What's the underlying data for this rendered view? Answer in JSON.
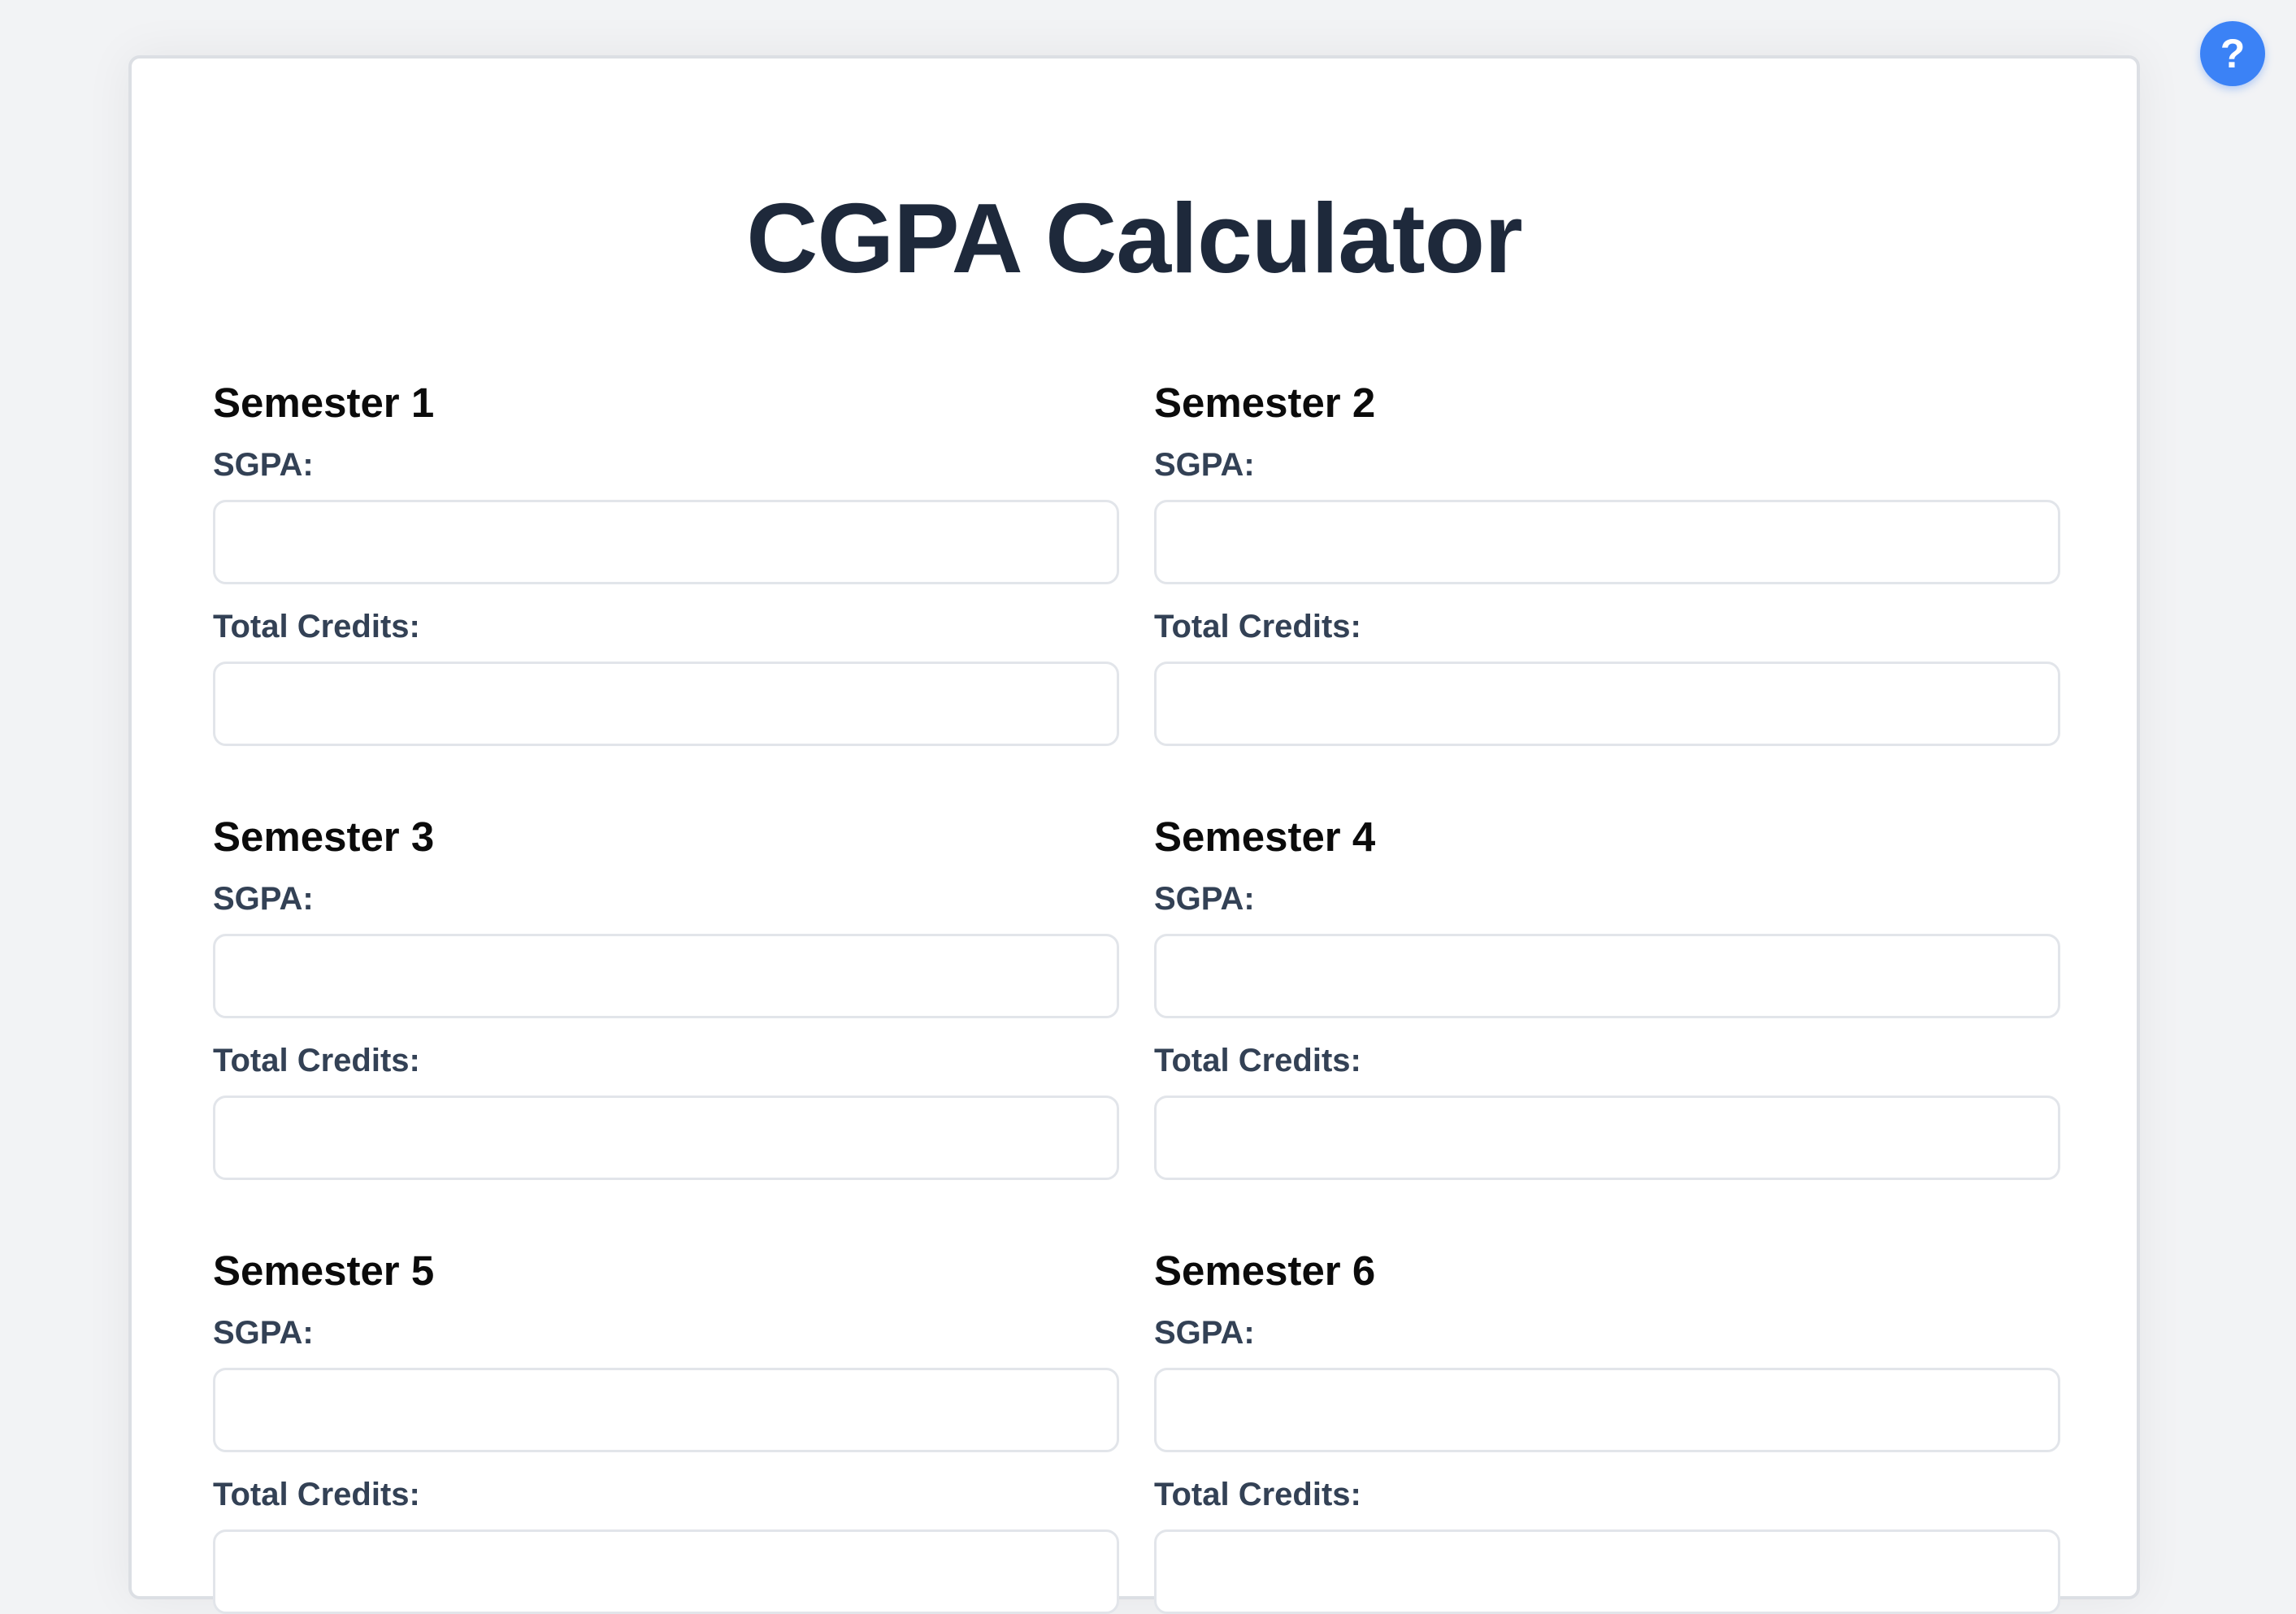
{
  "page": {
    "title": "CGPA Calculator",
    "help_icon": "question-mark-icon",
    "help_glyph": "?"
  },
  "semesters": [
    {
      "heading": "Semester 1",
      "sgpa_label": "SGPA:",
      "sgpa_value": "",
      "credits_label": "Total Credits:",
      "credits_value": ""
    },
    {
      "heading": "Semester 2",
      "sgpa_label": "SGPA:",
      "sgpa_value": "",
      "credits_label": "Total Credits:",
      "credits_value": ""
    },
    {
      "heading": "Semester 3",
      "sgpa_label": "SGPA:",
      "sgpa_value": "",
      "credits_label": "Total Credits:",
      "credits_value": ""
    },
    {
      "heading": "Semester 4",
      "sgpa_label": "SGPA:",
      "sgpa_value": "",
      "credits_label": "Total Credits:",
      "credits_value": ""
    },
    {
      "heading": "Semester 5",
      "sgpa_label": "SGPA:",
      "sgpa_value": "",
      "credits_label": "Total Credits:",
      "credits_value": ""
    },
    {
      "heading": "Semester 6",
      "sgpa_label": "SGPA:",
      "sgpa_value": "",
      "credits_label": "Total Credits:",
      "credits_value": ""
    }
  ],
  "colors": {
    "background": "#f2f3f5",
    "title": "#1e293b",
    "label": "#334155",
    "accent": "#3b82f6",
    "input_border": "#e2e5ea"
  }
}
